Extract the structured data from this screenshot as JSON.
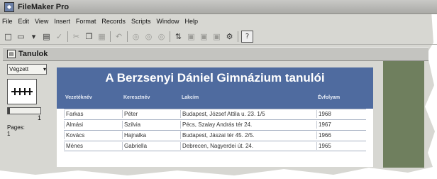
{
  "app": {
    "title": "FileMaker Pro"
  },
  "menu": [
    "File",
    "Edit",
    "View",
    "Insert",
    "Format",
    "Records",
    "Scripts",
    "Window",
    "Help"
  ],
  "document": {
    "title": "Tanulok"
  },
  "status": {
    "layout_select": "Végzett",
    "record_number": "1",
    "pages_label": "Pages:",
    "pages_value": "1"
  },
  "table": {
    "title": "A Berzsenyi Dániel Gimnázium tanulói",
    "headers": [
      "Vezetéknév",
      "Keresztnév",
      "Lakcím",
      "Évfolyam"
    ],
    "rows": [
      [
        "Farkas",
        "Péter",
        "Budapest, József Attila u. 23. 1/5",
        "1968"
      ],
      [
        "Almási",
        "Szilvia",
        "Pécs, Szalay András tér 24.",
        "1967"
      ],
      [
        "Kovács",
        "Hajnalka",
        "Budapest, Jászai tér 45. 2/5.",
        "1966"
      ],
      [
        "Ménes",
        "Gabriella",
        "Debrecen, Nagyerdei út. 24.",
        "1965"
      ]
    ]
  },
  "colors": {
    "header_band": "#4f6b9f",
    "side_panel": "#6f7f5e"
  }
}
